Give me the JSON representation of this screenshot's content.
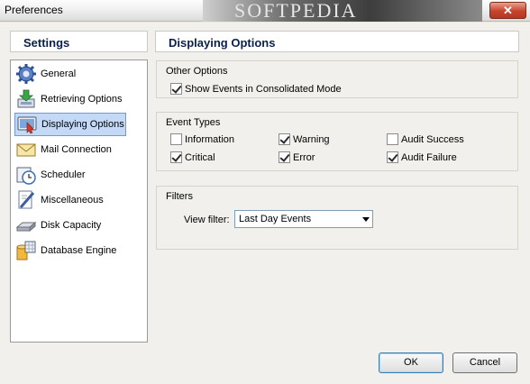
{
  "window": {
    "title": "Preferences",
    "watermark": "SOFTPEDIA",
    "close_symbol": "✕"
  },
  "sidebar": {
    "header": "Settings",
    "items": [
      {
        "label": "General",
        "icon": "gear-icon"
      },
      {
        "label": "Retrieving Options",
        "icon": "download-icon"
      },
      {
        "label": "Displaying Options",
        "icon": "display-icon",
        "selected": true
      },
      {
        "label": "Mail Connection",
        "icon": "mail-icon"
      },
      {
        "label": "Scheduler",
        "icon": "clock-icon"
      },
      {
        "label": "Miscellaneous",
        "icon": "tools-icon"
      },
      {
        "label": "Disk Capacity",
        "icon": "disk-icon"
      },
      {
        "label": "Database Engine",
        "icon": "database-icon"
      }
    ]
  },
  "main": {
    "header": "Displaying Options",
    "other_options": {
      "title": "Other Options",
      "show_consolidated": {
        "label": "Show Events in Consolidated Mode",
        "checked": true
      }
    },
    "event_types": {
      "title": "Event Types",
      "information": {
        "label": "Information",
        "checked": false
      },
      "warning": {
        "label": "Warning",
        "checked": true
      },
      "audit_success": {
        "label": "Audit Success",
        "checked": false
      },
      "critical": {
        "label": "Critical",
        "checked": true
      },
      "error": {
        "label": "Error",
        "checked": true
      },
      "audit_failure": {
        "label": "Audit Failure",
        "checked": true
      }
    },
    "filters": {
      "title": "Filters",
      "view_filter_label": "View filter:",
      "view_filter_value": "Last Day Events"
    }
  },
  "footer": {
    "ok_label": "OK",
    "cancel_label": "Cancel"
  }
}
